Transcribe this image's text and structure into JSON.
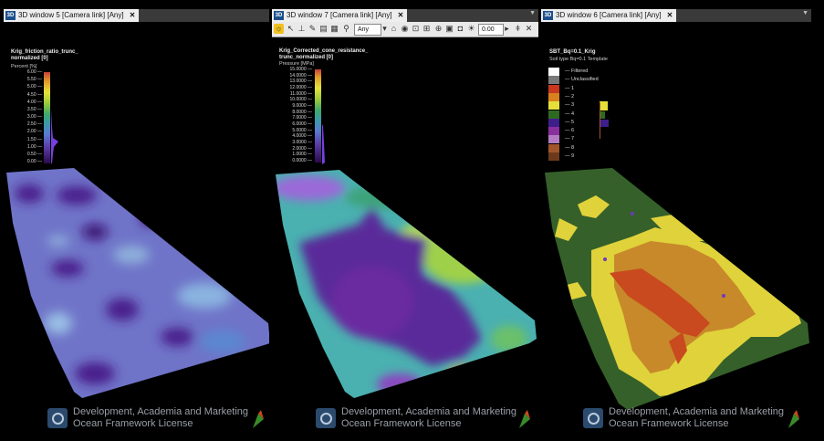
{
  "windows": [
    {
      "tab_label": "3D window 5 [Camera link] [Any]",
      "legend_title": "Krig_friction_ratio_trunc_\nnormalized [0]",
      "legend_unit": "Percent [%]",
      "ticks": [
        "6.00",
        "5.50",
        "5.00",
        "4.50",
        "4.00",
        "3.50",
        "3.00",
        "2.50",
        "2.00",
        "1.50",
        "1.00",
        "0.50",
        "0.00"
      ]
    },
    {
      "tab_label": "3D window 7 [Camera link] [Any]",
      "toolbar_select": "Any",
      "toolbar_value": "0.00",
      "legend_title": "Krig_Corrected_cone_resistance_\ntrunc_normalized [0]",
      "legend_unit": "Pressure [MPa]",
      "ticks": [
        "15.0000",
        "14.0000",
        "13.0000",
        "12.0000",
        "11.0000",
        "10.0000",
        "9.0000",
        "8.0000",
        "7.0000",
        "6.0000",
        "5.0000",
        "4.0000",
        "3.0000",
        "2.0000",
        "1.0000",
        "0.0000"
      ]
    },
    {
      "tab_label": "3D window 6 [Camera link] [Any]",
      "legend_title": "SBT_Bq=0.1_Krig",
      "legend_unit": "Soil type Bq=0.1 Template",
      "categories": [
        "Filtered",
        "Unclassified",
        "1",
        "2",
        "3",
        "4",
        "5",
        "6",
        "7",
        "8",
        "9"
      ]
    }
  ],
  "license": {
    "line1": "Development, Academia and Marketing",
    "line2": "Ocean Framework License"
  },
  "colors": {
    "cat_colors": [
      "#ffffff",
      "#7a7a7a",
      "#c8371e",
      "#d9801f",
      "#e6df3a",
      "#2f6a22",
      "#3e1e8a",
      "#8a2f9e",
      "#b47cc2",
      "#a0562a",
      "#6b3a1c"
    ]
  }
}
